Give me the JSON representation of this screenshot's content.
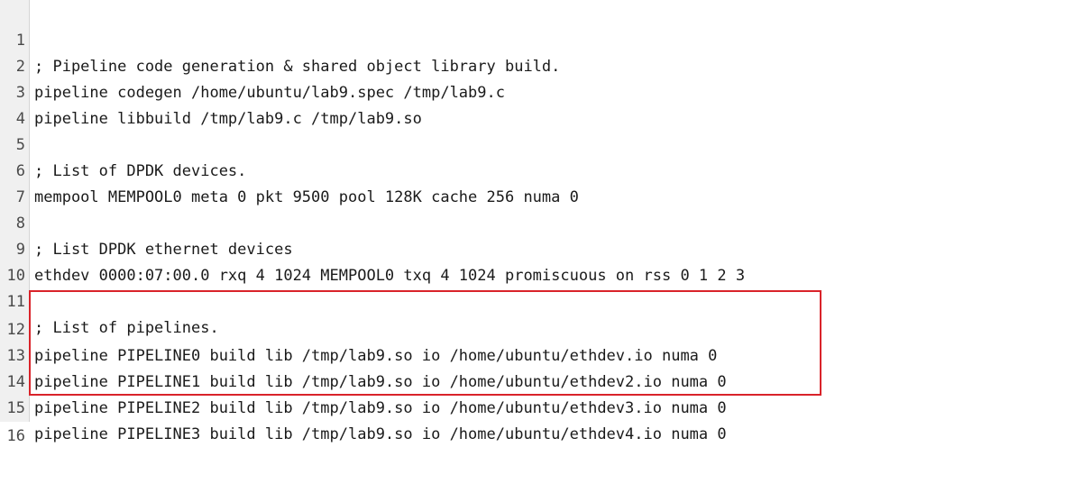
{
  "editor": {
    "lines": [
      {
        "number": "1",
        "text": "; Pipeline code generation & shared object library build."
      },
      {
        "number": "2",
        "text": "pipeline codegen /home/ubuntu/lab9.spec /tmp/lab9.c"
      },
      {
        "number": "3",
        "text": "pipeline libbuild /tmp/lab9.c /tmp/lab9.so"
      },
      {
        "number": "4",
        "text": ""
      },
      {
        "number": "5",
        "text": "; List of DPDK devices."
      },
      {
        "number": "6",
        "text": "mempool MEMPOOL0 meta 0 pkt 9500 pool 128K cache 256 numa 0"
      },
      {
        "number": "7",
        "text": ""
      },
      {
        "number": "8",
        "text": "; List DPDK ethernet devices"
      },
      {
        "number": "9",
        "text": "ethdev 0000:07:00.0 rxq 4 1024 MEMPOOL0 txq 4 1024 promiscuous on rss 0 1 2 3"
      },
      {
        "number": "10",
        "text": ""
      },
      {
        "number": "11",
        "text": "; List of pipelines."
      },
      {
        "number": "12",
        "text": "pipeline PIPELINE0 build lib /tmp/lab9.so io /home/ubuntu/ethdev.io numa 0"
      },
      {
        "number": "13",
        "text": "pipeline PIPELINE1 build lib /tmp/lab9.so io /home/ubuntu/ethdev2.io numa 0"
      },
      {
        "number": "14",
        "text": "pipeline PIPELINE2 build lib /tmp/lab9.so io /home/ubuntu/ethdev3.io numa 0"
      },
      {
        "number": "15",
        "text": "pipeline PIPELINE3 build lib /tmp/lab9.so io /home/ubuntu/ethdev4.io numa 0"
      },
      {
        "number": "16",
        "text": ""
      }
    ],
    "highlight": {
      "color": "#d9232a",
      "lines": [
        "12",
        "13",
        "14",
        "15"
      ]
    }
  }
}
